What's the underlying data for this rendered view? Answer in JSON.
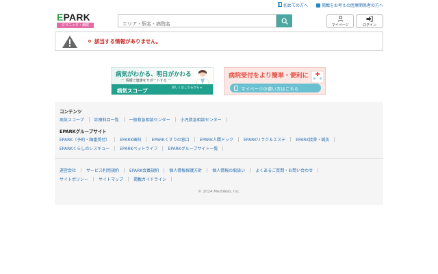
{
  "top_links": {
    "first_time": "初めての方へ",
    "for_medical": "掲載をお考えの医療関係者の方へ"
  },
  "logo": {
    "word_e": "E",
    "word_rest": "PARK",
    "tagline": "クリニック・病院"
  },
  "search": {
    "placeholder": "エリア・駅名・病院名",
    "value": ""
  },
  "header_buttons": {
    "mypage": "マイページ",
    "login": "ログイン"
  },
  "notice": {
    "message": "該当する情報がありません。"
  },
  "banners": {
    "left": {
      "headline": "病気がわかる、明日がかわる",
      "sub": "ー 情報で健康をサポートする ー",
      "brand": "病気スコープ",
      "cta": "詳しくはこちらから ▸"
    },
    "right": {
      "headline": "病院受付をより簡単・便利に",
      "cta": "マイページの使い方はこちら"
    }
  },
  "footer": {
    "contents_heading": "コンテンツ",
    "contents_links": [
      "病気スコープ",
      "診療科目一覧",
      "一般救急相談センター",
      "小児救急相談センター"
    ],
    "group_heading": "EPARKグループサイト",
    "group_links_row1": [
      "EPARK（予約・順番受付）",
      "EPARK歯科",
      "EPARKくすりの窓口",
      "EPARK人間ドック",
      "EPARKリラク＆エステ",
      "EPARK接骨・鍼灸"
    ],
    "group_links_row2": [
      "EPARKくらしのレスキュー",
      "EPARKペットライフ",
      "EPARKグループサイト一覧"
    ],
    "corp_links_row1": [
      "運営会社",
      "サービス利用規約",
      "EPARK会員規約",
      "個人情報保護方針",
      "個人情報の取扱い",
      "よくあるご質問・お問い合わせ"
    ],
    "corp_links_row2": [
      "サイトポリシー",
      "サイトマップ",
      "掲載ガイドライン"
    ],
    "copyright": "© 2024 MediWeb, Inc."
  },
  "colors": {
    "accent_teal": "#4aa7a2",
    "logo_pink": "#e46aa5",
    "error_red": "#c8302a",
    "link_blue": "#2a6fb0"
  }
}
